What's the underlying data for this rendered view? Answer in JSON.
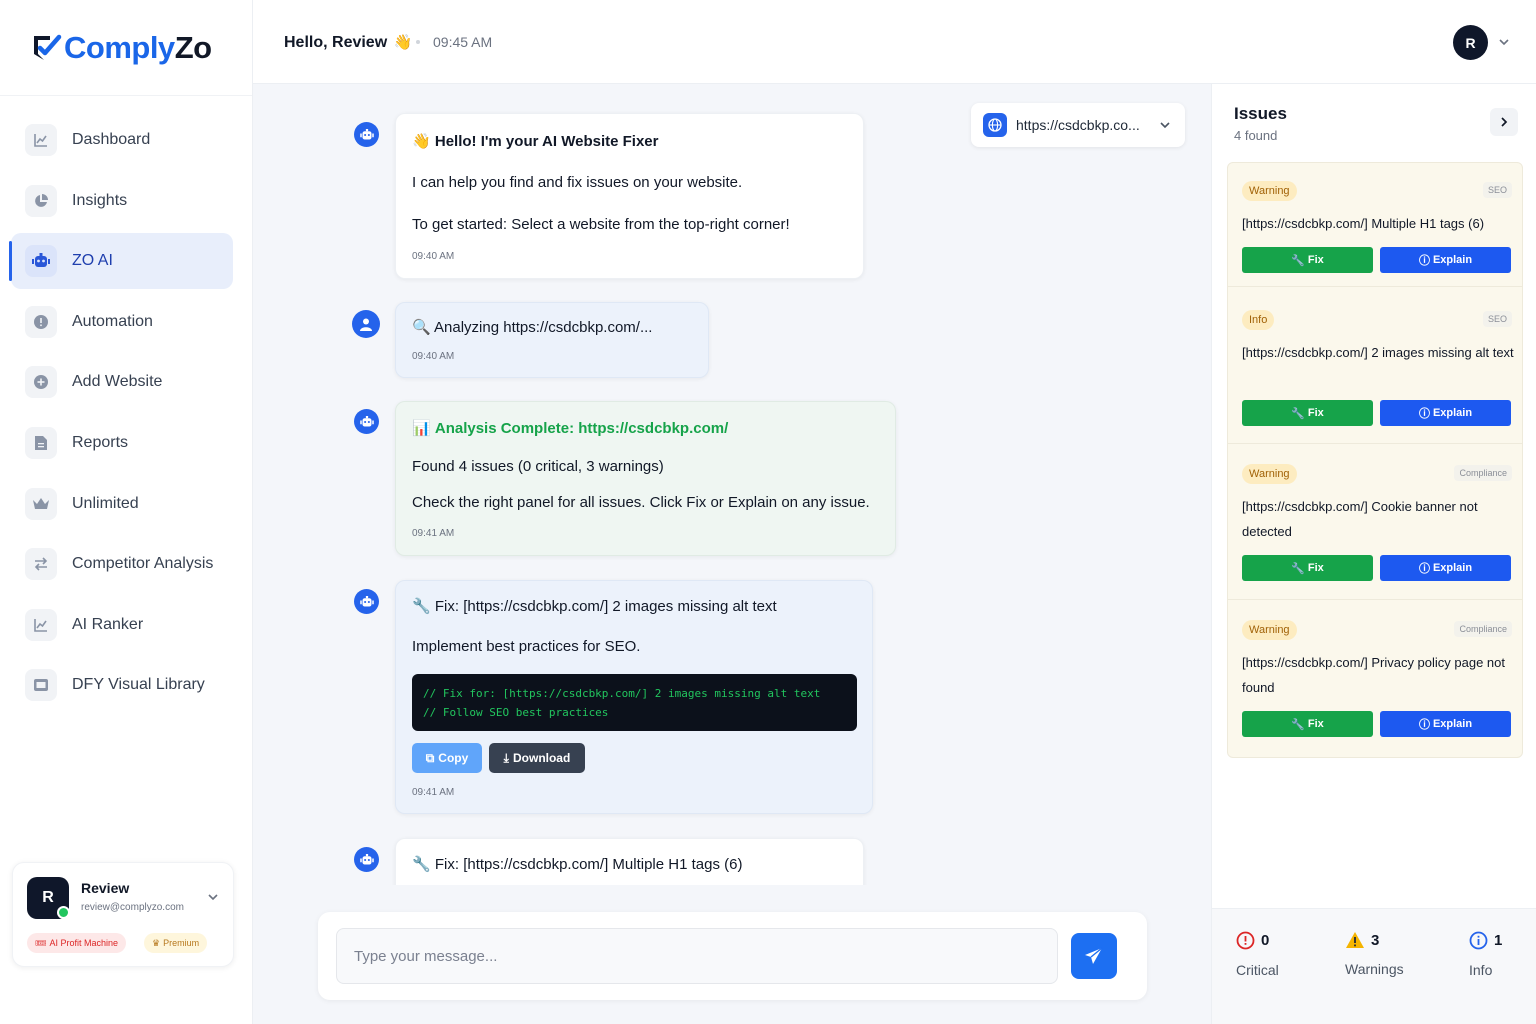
{
  "brand": {
    "name_part1": "Comply",
    "name_part2": "Zo",
    "accent": "#1a66e8"
  },
  "sidebar": {
    "items": [
      {
        "label": "Dashboard",
        "icon": "chart-line-icon"
      },
      {
        "label": "Insights",
        "icon": "pie-chart-icon"
      },
      {
        "label": "ZO AI",
        "icon": "robot-icon",
        "active": true
      },
      {
        "label": "Automation",
        "icon": "info-circle-icon"
      },
      {
        "label": "Add Website",
        "icon": "plus-circle-icon"
      },
      {
        "label": "Reports",
        "icon": "document-icon"
      },
      {
        "label": "Unlimited",
        "icon": "crown-icon"
      },
      {
        "label": "Competitor Analysis",
        "icon": "swap-icon"
      },
      {
        "label": "AI Ranker",
        "icon": "chart-line-icon"
      },
      {
        "label": "DFY Visual Library",
        "icon": "image-icon"
      }
    ],
    "user": {
      "initial": "R",
      "name": "Review",
      "email": "review@complyzo.com",
      "badge_plan": "AI Profit Machine",
      "badge_tier": "Premium"
    }
  },
  "header": {
    "greeting": "Hello, Review",
    "wave": "👋",
    "time": "09:45 AM",
    "avatar_initial": "R"
  },
  "site_selector": {
    "value": "https://csdcbkp.co..."
  },
  "messages": {
    "m1": {
      "emoji": "👋",
      "title": "Hello! I'm your AI Website Fixer",
      "line1": "I can help you find and fix issues on your website.",
      "line2": "To get started: Select a website from the top-right corner!",
      "time": "09:40 AM"
    },
    "m2": {
      "text": "Analyzing https://csdcbkp.com/...",
      "time": "09:40 AM"
    },
    "m3": {
      "title": "Analysis Complete: https://csdcbkp.com/",
      "line1": "Found 4 issues (0 critical, 3 warnings)",
      "line2": "Check the right panel for all issues. Click Fix or Explain on any issue.",
      "time": "09:41 AM"
    },
    "m4": {
      "title": "Fix: [https://csdcbkp.com/] 2 images missing alt text",
      "line1": "Implement best practices for SEO.",
      "code_line1": "// Fix for: [https://csdcbkp.com/] 2 images missing alt text",
      "code_line2": "// Follow SEO best practices",
      "copy_label": "Copy",
      "download_label": "Download",
      "time": "09:41 AM"
    },
    "m5": {
      "title": "Fix: [https://csdcbkp.com/] Multiple H1 tags (6)"
    }
  },
  "composer": {
    "placeholder": "Type your message..."
  },
  "issues_panel": {
    "title": "Issues",
    "count_text": "4 found",
    "fix_label": "Fix",
    "explain_label": "Explain",
    "issues": [
      {
        "severity": "Warning",
        "category": "SEO",
        "text": "[https://csdcbkp.com/] Multiple H1 tags (6)"
      },
      {
        "severity": "Info",
        "category": "SEO",
        "text": "[https://csdcbkp.com/] 2 images missing alt text"
      },
      {
        "severity": "Warning",
        "category": "Compliance",
        "text": "[https://csdcbkp.com/] Cookie banner not detected"
      },
      {
        "severity": "Warning",
        "category": "Compliance",
        "text": "[https://csdcbkp.com/] Privacy policy page not found"
      }
    ],
    "summary": {
      "critical_count": "0",
      "critical_label": "Critical",
      "warnings_count": "3",
      "warnings_label": "Warnings",
      "info_count": "1",
      "info_label": "Info"
    }
  },
  "colors": {
    "primary": "#2563eb",
    "success": "#16a34a",
    "warning_badge": "#fdecc0",
    "critical": "#dc2626"
  }
}
